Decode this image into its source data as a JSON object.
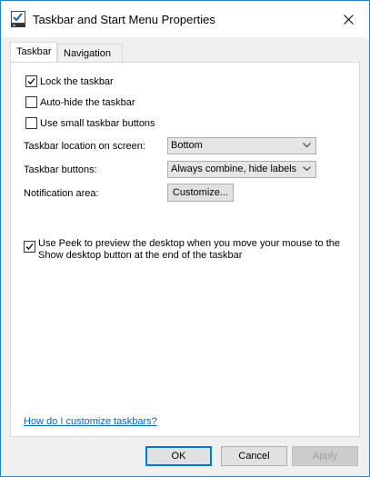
{
  "window": {
    "title": "Taskbar and Start Menu Properties",
    "accent_color": "#0078d7",
    "icons": {
      "app": "taskbar-app-icon",
      "close": "close-icon"
    }
  },
  "tabs": [
    {
      "label": "Taskbar",
      "active": true
    },
    {
      "label": "Navigation",
      "active": false
    }
  ],
  "options": {
    "lock_taskbar": {
      "label": "Lock the taskbar",
      "checked": true
    },
    "auto_hide": {
      "label": "Auto-hide the taskbar",
      "checked": false
    },
    "small_buttons": {
      "label": "Use small taskbar buttons",
      "checked": false
    }
  },
  "location": {
    "label": "Taskbar location on screen:",
    "selected": "Bottom"
  },
  "taskbar_buttons": {
    "label": "Taskbar buttons:",
    "selected": "Always combine, hide labels"
  },
  "notification": {
    "label": "Notification area:",
    "button": "Customize..."
  },
  "peek": {
    "line1": "Use Peek to preview the desktop when you move your mouse to the",
    "line2": "Show desktop button at the end of the taskbar",
    "checked": true
  },
  "help_link": "How do I customize taskbars?",
  "footer": {
    "ok": "OK",
    "cancel": "Cancel",
    "apply": "Apply"
  }
}
